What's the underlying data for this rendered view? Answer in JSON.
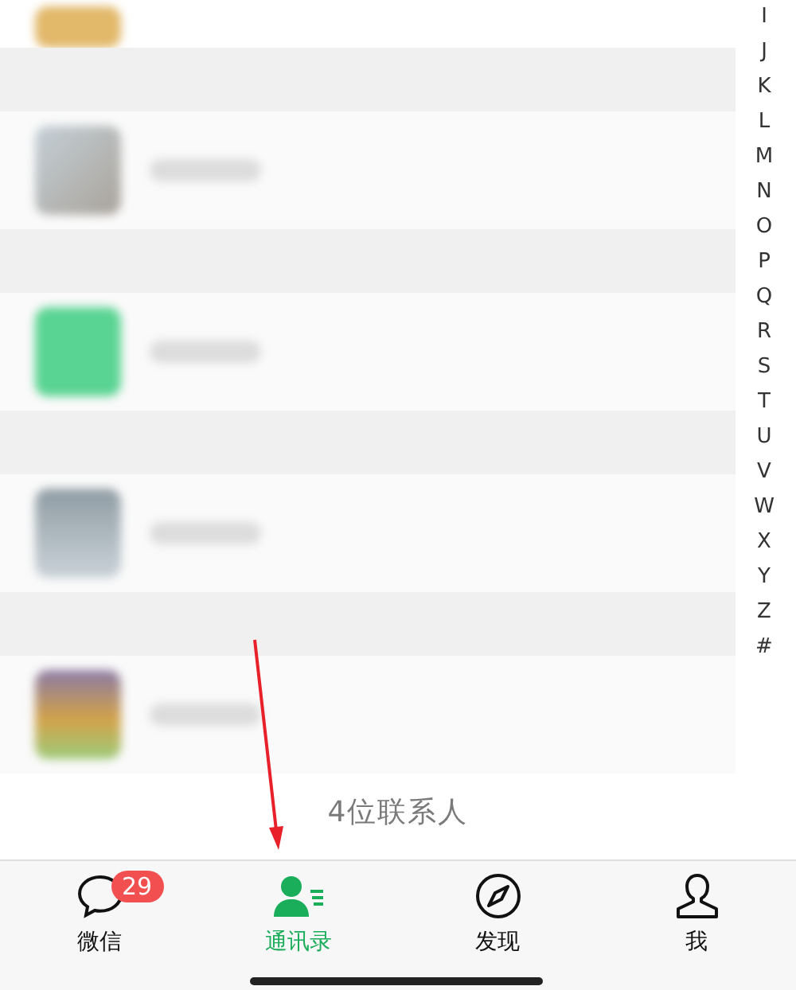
{
  "contacts": [
    {
      "kind": "cut"
    },
    {
      "kind": "blurred"
    },
    {
      "kind": "blurred"
    },
    {
      "kind": "blurred"
    },
    {
      "kind": "blurred"
    }
  ],
  "index_letters": [
    "I",
    "J",
    "K",
    "L",
    "M",
    "N",
    "O",
    "P",
    "Q",
    "R",
    "S",
    "T",
    "U",
    "V",
    "W",
    "X",
    "Y",
    "Z",
    "#"
  ],
  "contact_count": "4位联系人",
  "tabs": [
    {
      "kind": "chat",
      "label": "微信",
      "badge": "29",
      "selected": false
    },
    {
      "kind": "contacts",
      "label": "通讯录",
      "selected": true
    },
    {
      "kind": "discover",
      "label": "发现",
      "selected": false
    },
    {
      "kind": "me",
      "label": "我",
      "selected": false
    }
  ]
}
